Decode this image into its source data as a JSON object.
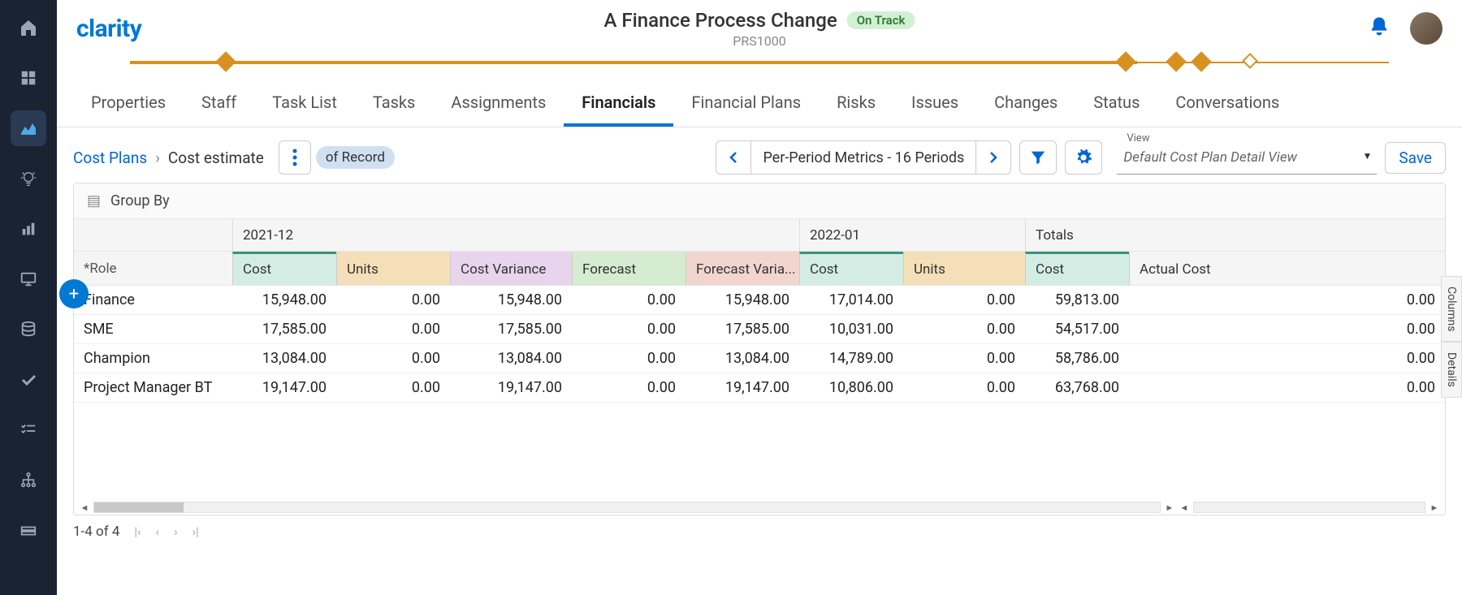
{
  "logo": "clarity",
  "header": {
    "title": "A Finance Process Change",
    "subtitle": "PRS1000",
    "status": "On Track"
  },
  "tabs": [
    "Properties",
    "Staff",
    "Task List",
    "Tasks",
    "Assignments",
    "Financials",
    "Financial Plans",
    "Risks",
    "Issues",
    "Changes",
    "Status",
    "Conversations"
  ],
  "active_tab": "Financials",
  "breadcrumb": {
    "root": "Cost Plans",
    "current": "Cost estimate",
    "record_chip": "of Record"
  },
  "pager_label": "Per-Period Metrics - 16 Periods",
  "view": {
    "label": "View",
    "value": "Default Cost Plan Detail View"
  },
  "save_label": "Save",
  "groupby_label": "Group By",
  "periods": {
    "p1": "2021-12",
    "p2": "2022-01",
    "totals": "Totals"
  },
  "columns": {
    "role": "*Role",
    "cost": "Cost",
    "units": "Units",
    "costvar": "Cost Variance",
    "forecast": "Forecast",
    "fcvar": "Forecast Varia...",
    "cost2": "Cost",
    "units2": "Units",
    "tcost": "Cost",
    "actual": "Actual Cost"
  },
  "rows": [
    {
      "role": "Finance",
      "cost": "15,948.00",
      "units": "0.00",
      "cv": "15,948.00",
      "fc": "0.00",
      "fcv": "15,948.00",
      "cost2": "17,014.00",
      "units2": "0.00",
      "tcost": "59,813.00",
      "actual": "0.00"
    },
    {
      "role": "SME",
      "cost": "17,585.00",
      "units": "0.00",
      "cv": "17,585.00",
      "fc": "0.00",
      "fcv": "17,585.00",
      "cost2": "10,031.00",
      "units2": "0.00",
      "tcost": "54,517.00",
      "actual": "0.00"
    },
    {
      "role": "Champion",
      "cost": "13,084.00",
      "units": "0.00",
      "cv": "13,084.00",
      "fc": "0.00",
      "fcv": "13,084.00",
      "cost2": "14,789.00",
      "units2": "0.00",
      "tcost": "58,786.00",
      "actual": "0.00"
    },
    {
      "role": "Project Manager BT",
      "cost": "19,147.00",
      "units": "0.00",
      "cv": "19,147.00",
      "fc": "0.00",
      "fcv": "19,147.00",
      "cost2": "10,806.00",
      "units2": "0.00",
      "tcost": "63,768.00",
      "actual": "0.00"
    }
  ],
  "footer_count": "1-4 of 4",
  "side_tabs": {
    "columns": "Columns",
    "details": "Details"
  }
}
